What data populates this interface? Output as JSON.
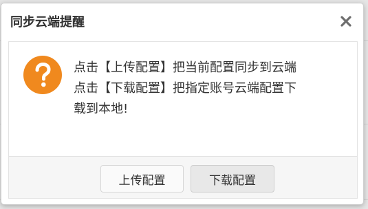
{
  "dialog": {
    "title": "同步云端提醒",
    "icon": "question-icon",
    "message_lines": [
      "点击【上传配置】把当前配置同步到云端",
      "点击【下载配置】把指定账号云端配置下",
      "载到本地!"
    ],
    "buttons": {
      "upload_label": "上传配置",
      "download_label": "下载配置"
    },
    "colors": {
      "icon_orange": "#f0891e",
      "title_text": "#333333"
    }
  }
}
